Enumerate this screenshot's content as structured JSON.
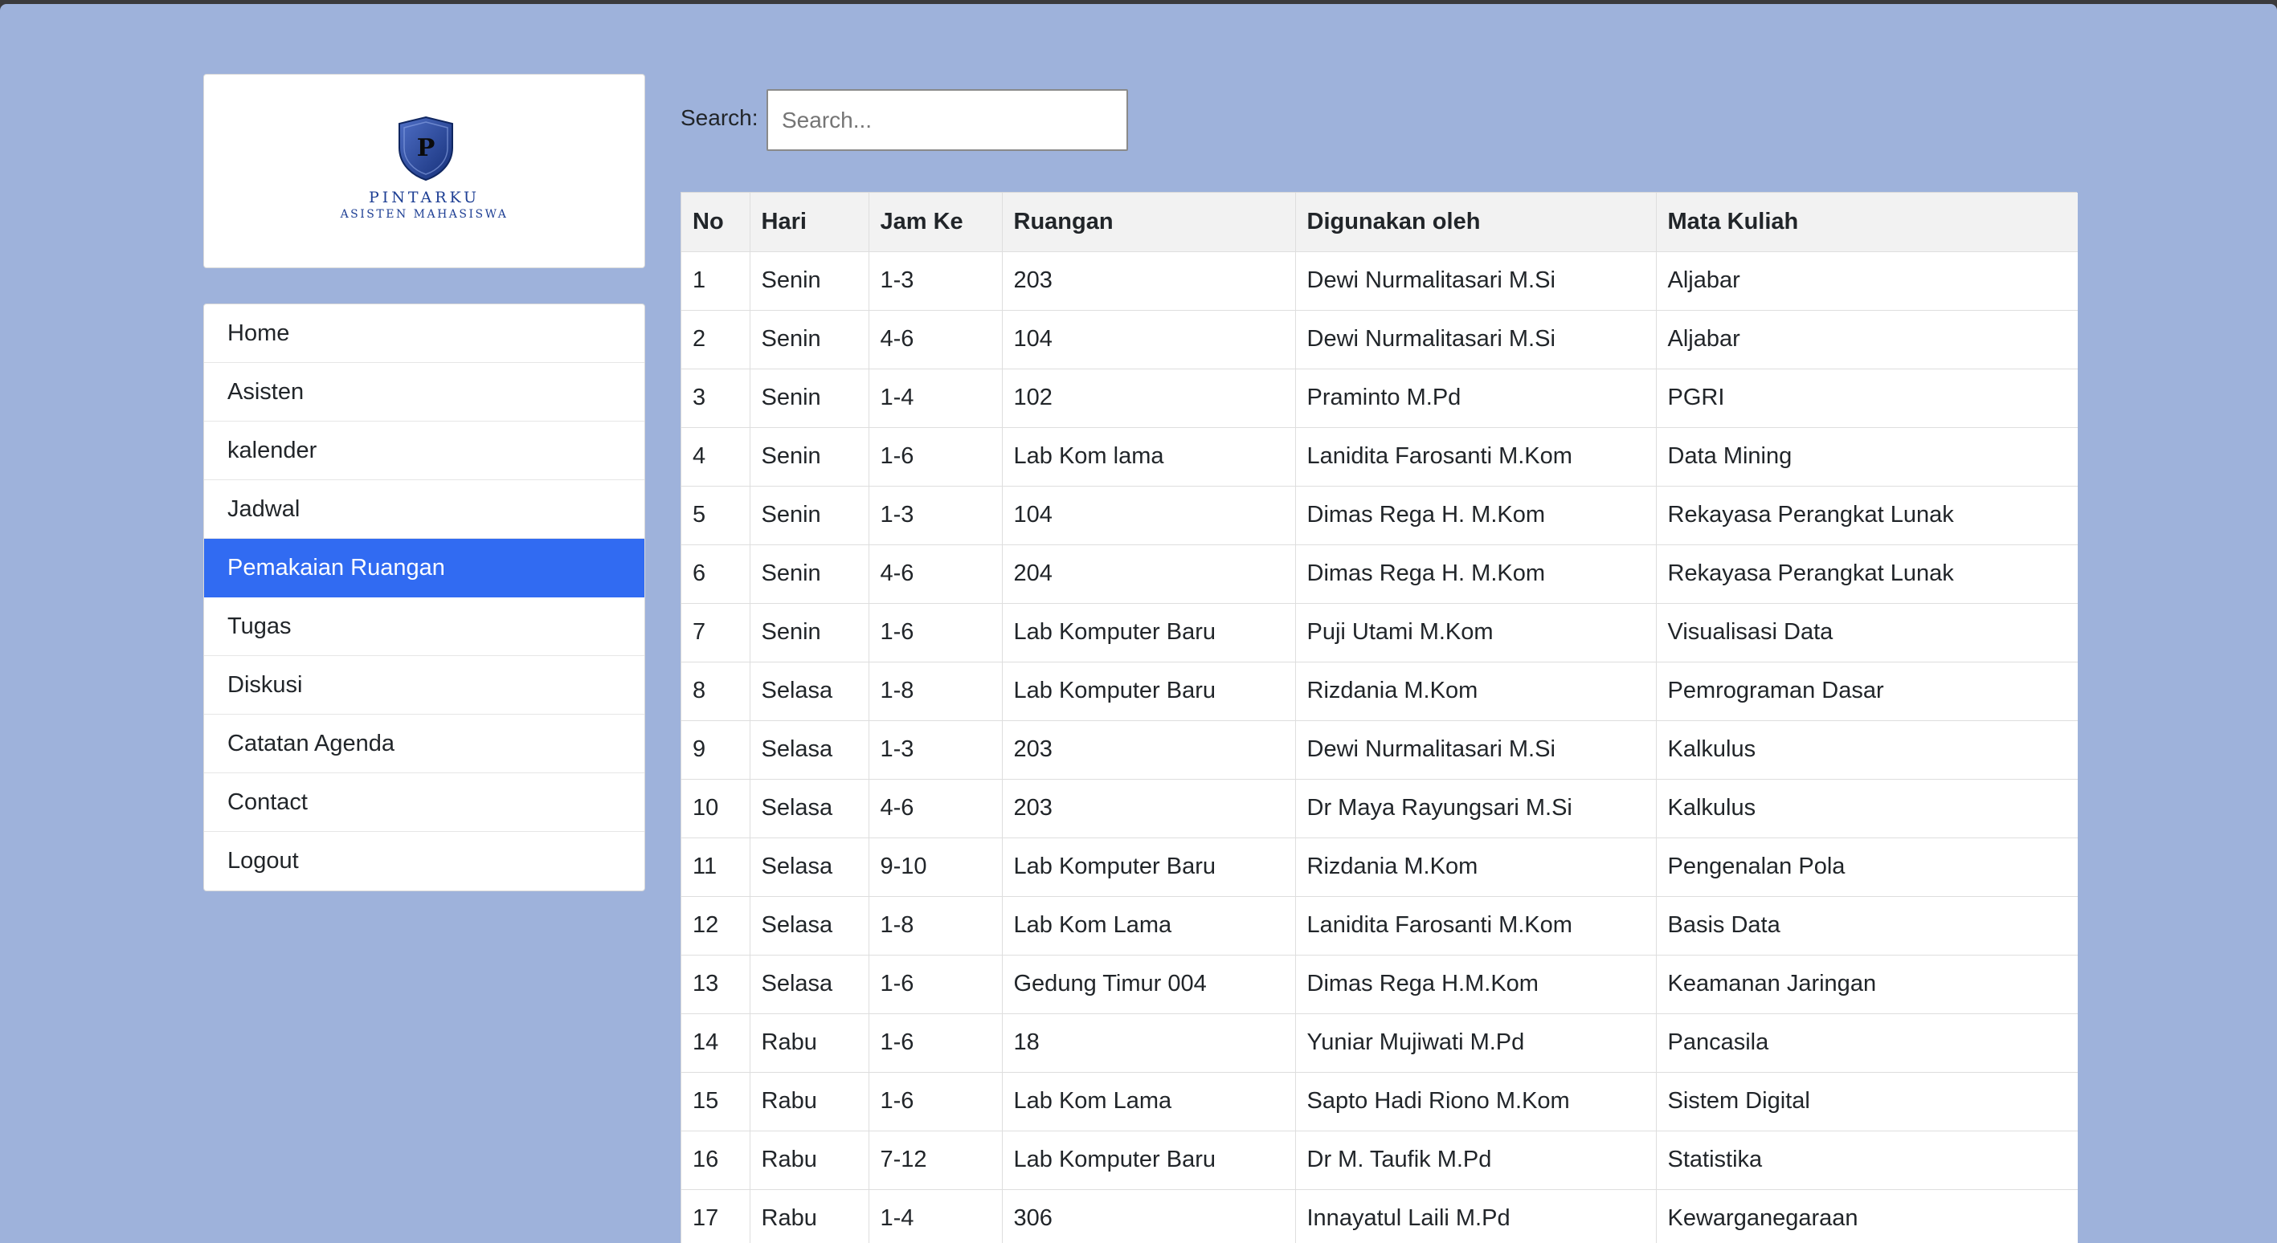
{
  "logo": {
    "letter": "P",
    "title": "PINTARKU",
    "subtitle": "ASISTEN MAHASISWA"
  },
  "nav": {
    "items": [
      {
        "label": "Home",
        "active": false
      },
      {
        "label": "Asisten",
        "active": false
      },
      {
        "label": "kalender",
        "active": false
      },
      {
        "label": "Jadwal",
        "active": false
      },
      {
        "label": "Pemakaian Ruangan",
        "active": true
      },
      {
        "label": "Tugas",
        "active": false
      },
      {
        "label": "Diskusi",
        "active": false
      },
      {
        "label": "Catatan Agenda",
        "active": false
      },
      {
        "label": "Contact",
        "active": false
      },
      {
        "label": "Logout",
        "active": false
      }
    ]
  },
  "search": {
    "label": "Search:",
    "placeholder": "Search...",
    "value": ""
  },
  "table": {
    "headers": [
      "No",
      "Hari",
      "Jam Ke",
      "Ruangan",
      "Digunakan oleh",
      "Mata Kuliah"
    ],
    "rows": [
      [
        "1",
        "Senin",
        "1-3",
        "203",
        "Dewi Nurmalitasari M.Si",
        "Aljabar"
      ],
      [
        "2",
        "Senin",
        "4-6",
        "104",
        "Dewi Nurmalitasari M.Si",
        "Aljabar"
      ],
      [
        "3",
        "Senin",
        "1-4",
        "102",
        "Praminto M.Pd",
        "PGRI"
      ],
      [
        "4",
        "Senin",
        "1-6",
        "Lab Kom lama",
        "Lanidita Farosanti M.Kom",
        "Data Mining"
      ],
      [
        "5",
        "Senin",
        "1-3",
        "104",
        "Dimas Rega H. M.Kom",
        "Rekayasa Perangkat Lunak"
      ],
      [
        "6",
        "Senin",
        "4-6",
        "204",
        "Dimas Rega H. M.Kom",
        "Rekayasa Perangkat Lunak"
      ],
      [
        "7",
        "Senin",
        "1-6",
        "Lab Komputer Baru",
        "Puji Utami M.Kom",
        "Visualisasi Data"
      ],
      [
        "8",
        "Selasa",
        "1-8",
        "Lab Komputer Baru",
        "Rizdania M.Kom",
        "Pemrograman Dasar"
      ],
      [
        "9",
        "Selasa",
        "1-3",
        "203",
        "Dewi Nurmalitasari M.Si",
        "Kalkulus"
      ],
      [
        "10",
        "Selasa",
        "4-6",
        "203",
        "Dr Maya Rayungsari M.Si",
        "Kalkulus"
      ],
      [
        "11",
        "Selasa",
        "9-10",
        "Lab Komputer Baru",
        "Rizdania M.Kom",
        "Pengenalan Pola"
      ],
      [
        "12",
        "Selasa",
        "1-8",
        "Lab Kom Lama",
        "Lanidita Farosanti M.Kom",
        "Basis Data"
      ],
      [
        "13",
        "Selasa",
        "1-6",
        "Gedung Timur 004",
        "Dimas Rega H.M.Kom",
        "Keamanan Jaringan"
      ],
      [
        "14",
        "Rabu",
        "1-6",
        "18",
        "Yuniar Mujiwati M.Pd",
        "Pancasila"
      ],
      [
        "15",
        "Rabu",
        "1-6",
        "Lab Kom Lama",
        "Sapto Hadi Riono M.Kom",
        "Sistem Digital"
      ],
      [
        "16",
        "Rabu",
        "7-12",
        "Lab Komputer Baru",
        "Dr M. Taufik M.Pd",
        "Statistika"
      ],
      [
        "17",
        "Rabu",
        "1-4",
        "306",
        "Innayatul Laili M.Pd",
        "Kewarganegaraan"
      ]
    ]
  },
  "colors": {
    "page_background": "#9eb2db",
    "nav_active": "#316bf2",
    "logo_blue": "#1e3f94",
    "table_header_bg": "#f2f2f2"
  }
}
